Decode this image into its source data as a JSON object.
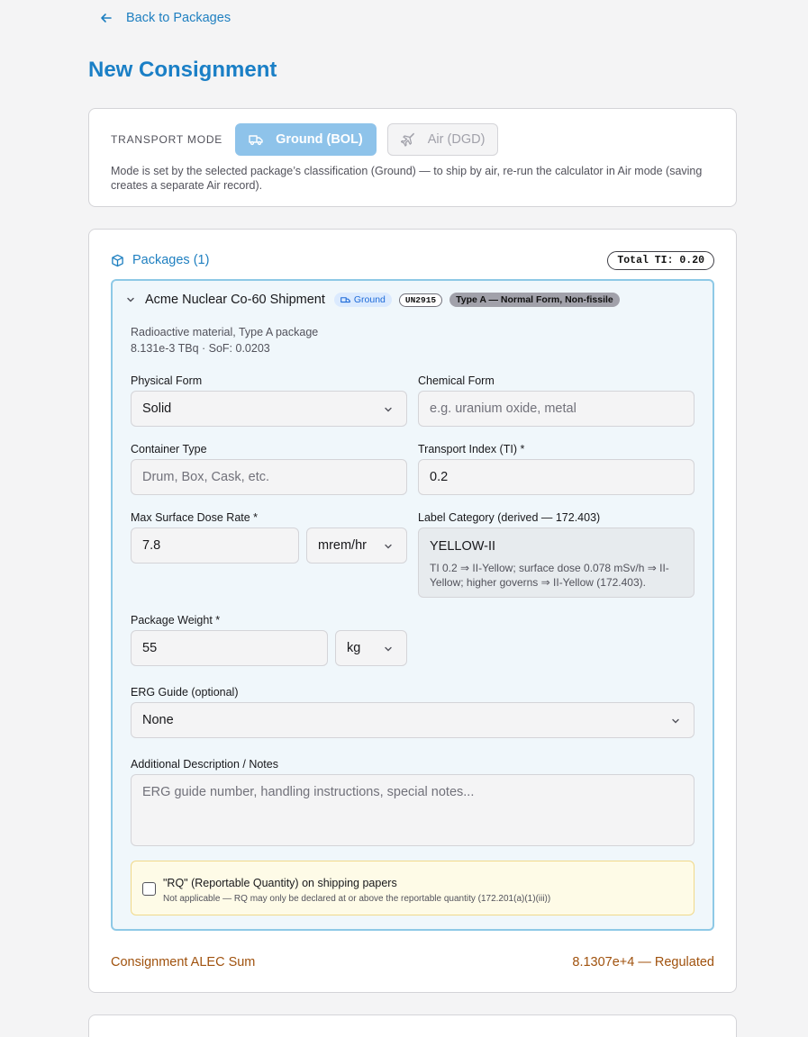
{
  "nav": {
    "back_label": "Back to Packages"
  },
  "page_title": "New Consignment",
  "transport": {
    "label": "TRANSPORT MODE",
    "ground_label": "Ground (BOL)",
    "air_label": "Air (DGD)",
    "selected": "Ground (BOL)",
    "note": "Mode is set by the selected package’s classification (Ground) — to ship by air, re-run the calculator in Air mode (saving creates a separate Air record)."
  },
  "packages": {
    "header": "Packages (1)",
    "total_ti": "Total TI: 0.20",
    "items": [
      {
        "name": "Acme Nuclear Co-60 Shipment",
        "mode_badge": "Ground",
        "un_badge": "UN2915",
        "type_badge": "Type A — Normal Form, Non-fissile",
        "description": "Radioactive material, Type A package",
        "activity_line": "8.131e-3 TBq · SoF: 0.0203",
        "physical_form": {
          "label": "Physical Form",
          "value": "Solid"
        },
        "chemical_form": {
          "label": "Chemical Form",
          "placeholder": "e.g. uranium oxide, metal"
        },
        "container_type": {
          "label": "Container Type",
          "placeholder": "Drum, Box, Cask, etc."
        },
        "transport_index": {
          "label": "Transport Index (TI) *",
          "value": "0.2"
        },
        "dose_rate": {
          "label": "Max Surface Dose Rate *",
          "value": "7.8",
          "unit": "mrem/hr"
        },
        "label_category": {
          "label": "Label Category (derived — 172.403)",
          "value": "YELLOW-II",
          "explanation": "TI 0.2 ⇒ II-Yellow; surface dose 0.078 mSv/h ⇒ II-Yellow; higher governs ⇒ II-Yellow (172.403)."
        },
        "weight": {
          "label": "Package Weight *",
          "value": "55",
          "unit": "kg"
        },
        "erg_guide": {
          "label": "ERG Guide (optional)",
          "value": "None"
        },
        "notes": {
          "label": "Additional Description / Notes",
          "placeholder": "ERG guide number, handling instructions, special notes..."
        },
        "rq": {
          "label": "\"RQ\" (Reportable Quantity) on shipping papers",
          "note": "Not applicable — RQ may only be declared at or above the reportable quantity (172.201(a)(1)(iii))",
          "checked": false
        }
      }
    ]
  },
  "alec": {
    "label": "Consignment ALEC Sum",
    "value": "8.1307e+4 — Regulated"
  },
  "colors": {
    "accent": "#1a7fc6",
    "alec": "#a0520e",
    "package_border": "#8ec9e6"
  }
}
